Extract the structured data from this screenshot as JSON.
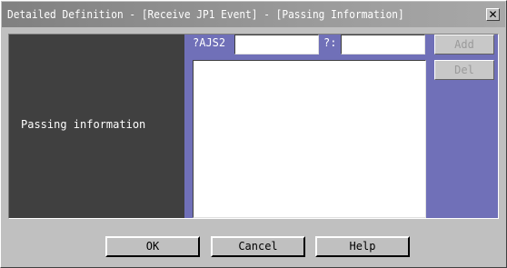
{
  "window": {
    "title": "Detailed Definition - [Receive JP1 Event] - [Passing Information]",
    "close_glyph": "✕"
  },
  "left_panel": {
    "label": "Passing information"
  },
  "form": {
    "field1_label": "?AJS2",
    "field1_value": "",
    "field2_label": "?:",
    "field2_value": ""
  },
  "buttons": {
    "add": "Add",
    "del": "Del",
    "ok": "OK",
    "cancel": "Cancel",
    "help": "Help"
  },
  "colors": {
    "left_panel": "#404040",
    "right_panel": "#7070b8",
    "dialog_bg": "#c0c0c0"
  }
}
